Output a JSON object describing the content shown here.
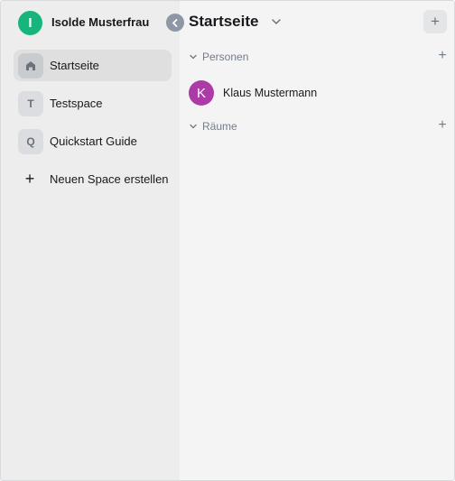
{
  "user": {
    "initial": "I",
    "name": "Isolde Musterfrau"
  },
  "sidebar": {
    "items": [
      {
        "tile": "home-icon",
        "label": "Startseite",
        "active": true
      },
      {
        "tile": "T",
        "label": "Testspace",
        "active": false
      },
      {
        "tile": "Q",
        "label": "Quickstart Guide",
        "active": false
      },
      {
        "tile": "+",
        "label": "Neuen Space erstellen",
        "active": false
      }
    ]
  },
  "main": {
    "title": "Startseite",
    "add_label": "+",
    "sections": [
      {
        "label": "Personen",
        "add": "+"
      },
      {
        "label": "Räume",
        "add": "+"
      }
    ],
    "people": [
      {
        "initial": "K",
        "name": "Klaus Mustermann"
      }
    ]
  },
  "colors": {
    "user_avatar": "#16b57b",
    "person_avatar": "#ac3ba8",
    "sidebar_bg": "#ededed",
    "main_bg": "#f4f4f4",
    "active_item": "#dfdfe0"
  }
}
